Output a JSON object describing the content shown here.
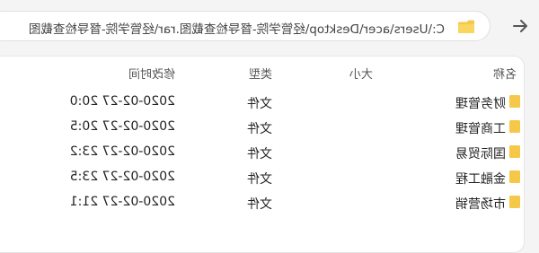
{
  "address_bar": {
    "path": "C:\\Users\\acer\\Desktop\\经管学院-督导检查截图.rar\\经管学院-督导检查截图"
  },
  "columns": {
    "name": "名称",
    "size": "大小",
    "type": "类型",
    "modified": "修改时间"
  },
  "rows": [
    {
      "name": "财务管理",
      "type": "文件",
      "modified": "2020-02-27 20:0"
    },
    {
      "name": "工商管理",
      "type": "文件",
      "modified": "2020-02-27 20:5"
    },
    {
      "name": "国际贸易",
      "type": "文件",
      "modified": "2020-02-27 23:2"
    },
    {
      "name": "金融工程",
      "type": "文件",
      "modified": "2020-02-27 23:5"
    },
    {
      "name": "市场营销",
      "type": "文件",
      "modified": "2020-02-27 21:1"
    }
  ],
  "colors": {
    "folder": "#f5c84a",
    "panel_bg": "#ffffff",
    "window_bg": "#f4f4f5"
  },
  "icons": [
    "back-arrow-icon",
    "folder-icon",
    "file-icon"
  ]
}
